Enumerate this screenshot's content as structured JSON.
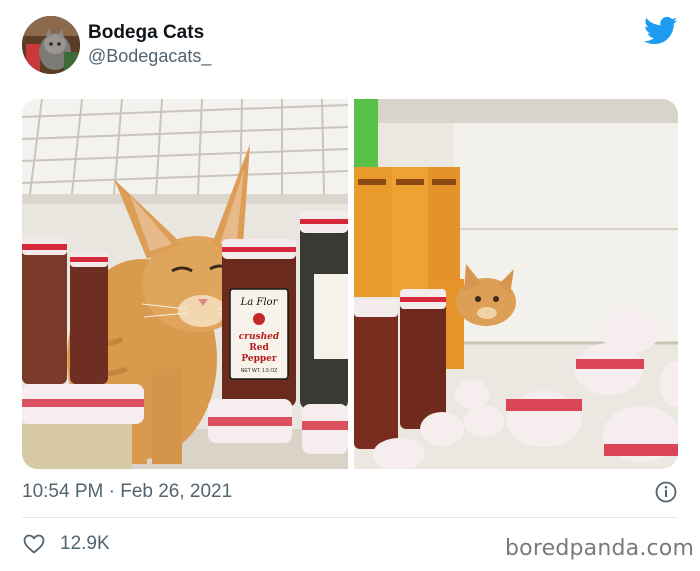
{
  "tweet": {
    "display_name": "Bodega Cats",
    "handle": "@Bodegacats_",
    "timestamp": "10:54 PM · Feb 26, 2021",
    "likes": "12.9K"
  },
  "media": {
    "left_photo": {
      "jar_brand": "La Flor",
      "jar_label_line1": "crushed",
      "jar_label_line2": "Red",
      "jar_label_line3": "Pepper",
      "jar_net_wt": "NET WT. 1.5 OZ"
    }
  },
  "watermark": "boredpanda.com",
  "colors": {
    "twitter_blue": "#1d9bf0",
    "secondary_text": "#536471",
    "jar_cap_red": "#d6283b"
  },
  "icons": {
    "brand": "twitter-bird-icon",
    "info": "info-circle-icon",
    "like": "heart-outline-icon"
  }
}
